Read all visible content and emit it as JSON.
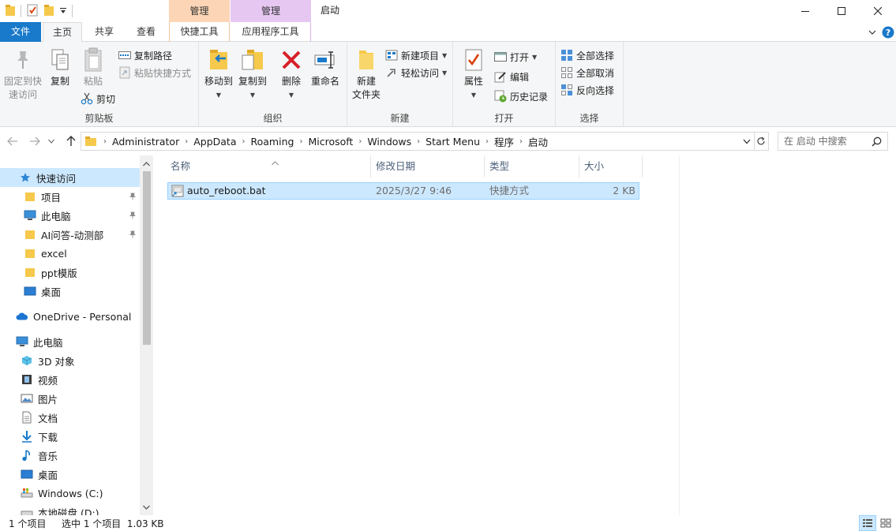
{
  "titlebar": {
    "context_tab_shortcut": "管理",
    "context_tab_app": "管理",
    "window_title": "启动"
  },
  "tabs": {
    "file": "文件",
    "home": "主页",
    "share": "共享",
    "view": "查看",
    "shortcut_tools": "快捷工具",
    "app_tools": "应用程序工具"
  },
  "ribbon": {
    "clipboard": {
      "label": "剪贴板",
      "pin_quick_access": "固定到快\n速访问",
      "copy": "复制",
      "paste": "粘贴",
      "copy_path": "复制路径",
      "paste_shortcut": "粘贴快捷方式",
      "cut": "剪切"
    },
    "organize": {
      "label": "组织",
      "move_to": "移动到",
      "copy_to": "复制到",
      "delete": "删除",
      "rename": "重命名"
    },
    "new": {
      "label": "新建",
      "new_folder": "新建\n文件夹",
      "new_item": "新建项目",
      "easy_access": "轻松访问"
    },
    "open": {
      "label": "打开",
      "properties": "属性",
      "open": "打开",
      "edit": "编辑",
      "history": "历史记录"
    },
    "select": {
      "label": "选择",
      "select_all": "全部选择",
      "select_none": "全部取消",
      "invert": "反向选择"
    }
  },
  "address": {
    "crumbs": [
      "Administrator",
      "AppData",
      "Roaming",
      "Microsoft",
      "Windows",
      "Start Menu",
      "程序",
      "启动"
    ]
  },
  "search": {
    "placeholder": "在 启动 中搜索"
  },
  "nav": {
    "items": [
      {
        "label": "快速访问",
        "icon": "star-icon"
      },
      {
        "label": "项目",
        "icon": "folder-icon"
      },
      {
        "label": "此电脑",
        "icon": "computer-icon"
      },
      {
        "label": "AI问答-动测部",
        "icon": "folder-icon"
      },
      {
        "label": "excel",
        "icon": "folder-icon"
      },
      {
        "label": "ppt模版",
        "icon": "folder-icon"
      },
      {
        "label": "桌面",
        "icon": "desktop-icon"
      },
      {
        "label": "OneDrive - Personal",
        "icon": "cloud-icon"
      },
      {
        "label": "此电脑",
        "icon": "computer-icon"
      },
      {
        "label": "3D 对象",
        "icon": "cube-icon"
      },
      {
        "label": "视频",
        "icon": "video-icon"
      },
      {
        "label": "图片",
        "icon": "picture-icon"
      },
      {
        "label": "文档",
        "icon": "document-icon"
      },
      {
        "label": "下载",
        "icon": "download-icon"
      },
      {
        "label": "音乐",
        "icon": "music-icon"
      },
      {
        "label": "桌面",
        "icon": "desktop-icon"
      },
      {
        "label": "Windows (C:)",
        "icon": "drive-icon"
      },
      {
        "label": "本地磁盘 (D:)",
        "icon": "drive-icon"
      }
    ]
  },
  "filelist": {
    "columns": {
      "name": "名称",
      "modified": "修改日期",
      "type": "类型",
      "size": "大小"
    },
    "rows": [
      {
        "name": "auto_reboot.bat",
        "modified": "2025/3/27 9:46",
        "type": "快捷方式",
        "size": "2 KB"
      }
    ]
  },
  "status": {
    "item_count": "1 个项目",
    "selected": "选中 1 个项目  1.03 KB"
  },
  "colors": {
    "file_tab": "#1979ca",
    "selection": "#cce8ff",
    "selection_border": "#99d1ff",
    "shortcut_context": "#fbd5b5",
    "app_context": "#e6c7f2"
  }
}
